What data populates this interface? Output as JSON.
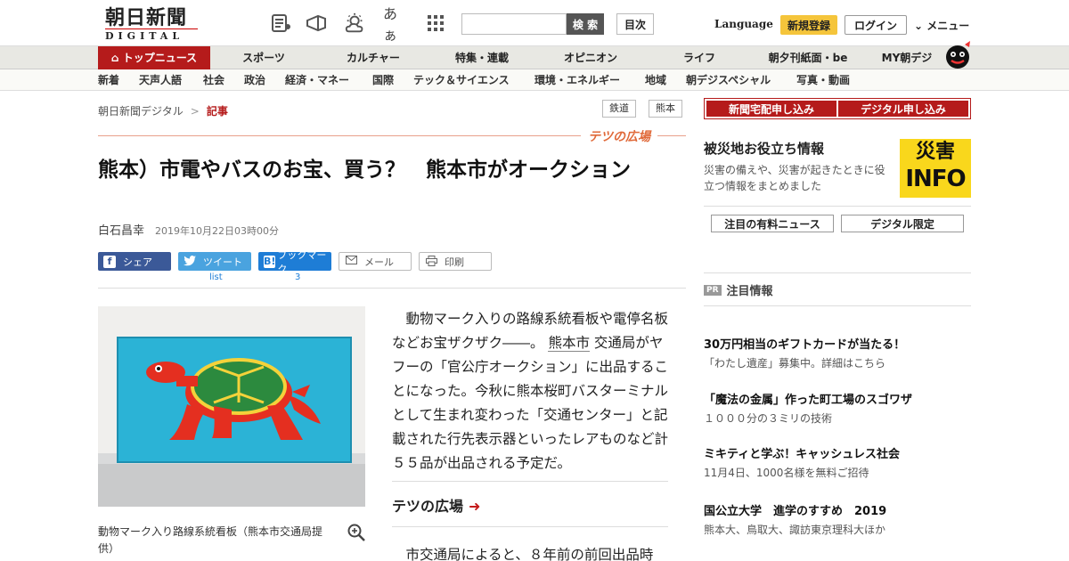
{
  "header": {
    "logo_jp": "朝日新聞",
    "logo_en": "DIGITAL",
    "icon_toggle_kana": "あぁ",
    "search_button": "検 索",
    "toc_button": "目次",
    "language": "Language",
    "register": "新規登録",
    "login": "ログイン",
    "menu": "メニュー"
  },
  "main_nav": [
    "トップニュース",
    "スポーツ",
    "カルチャー",
    "特集・連載",
    "オピニオン",
    "ライフ",
    "朝夕刊紙面・be",
    "MY朝デジ"
  ],
  "sub_nav": [
    "新着",
    "天声人語",
    "社会",
    "政治",
    "経済・マネー",
    "国際",
    "テック＆サイエンス",
    "環境・エネルギー",
    "地域",
    "朝デジスペシャル",
    "写真・動画"
  ],
  "breadcrumb": {
    "home": "朝日新聞デジタル",
    "separator": ">",
    "current": "記事"
  },
  "tags": [
    "鉄道",
    "熊本"
  ],
  "section_label": "テツの広場",
  "article": {
    "headline": "熊本）市電やバスのお宝、買う？　熊本市がオークション",
    "author": "白石昌幸",
    "date": "2019年10月22日03時00分",
    "caption": "動物マーク入り路線系統看板（熊本市交通局提供）",
    "body_before_link": "動物マーク入りの路線系統看板や電停名板などお宝ザクザク――。",
    "body_link": "熊本市",
    "body_after_link": "交通局がヤフーの「官公庁オークション」に出品することになった。今秋に熊本桜町バスターミナルとして生まれ変わった「交通センター」と記載された行先表示器といったレアものなど計５５品が出品される予定だ。",
    "related_link": "テツの広場",
    "body_next": "市交通局によると、８年前の前回出品時"
  },
  "share": {
    "facebook": "シェア",
    "twitter": "ツイート",
    "twitter_count": "list",
    "hatena_icon": "B!",
    "hatena": "ブックマーク",
    "hatena_count": "3",
    "mail": "メール",
    "print": "印刷"
  },
  "sidebar": {
    "subscribe_paper": "新聞宅配申し込み",
    "subscribe_digital": "デジタル申し込み",
    "disaster_title": "被災地お役立ち情報",
    "disaster_desc": "災害の備えや、災害が起きたときに役立つ情報をまとめました",
    "disaster_badge_top": "災害",
    "disaster_badge_bottom": "INFO",
    "pill_paid_news": "注目の有料ニュース",
    "pill_digital_only": "デジタル限定",
    "pr_tag": "PR",
    "pr_heading": "注目情報",
    "pr_items": [
      {
        "title": "30万円相当のギフトカードが当たる！",
        "desc": "「わたし遺産」募集中。詳細はこちら"
      },
      {
        "title": "「魔法の金属」作った町工場のスゴワザ",
        "desc": "１０００分の３ミリの技術"
      },
      {
        "title": "ミキティと学ぶ！キャッシュレス社会",
        "desc": "11月4日、1000名様を無料ご招待"
      },
      {
        "title": "国公立大学　進学のすすめ　2019",
        "desc": "熊本大、鳥取大、諏訪東京理科大ほか"
      }
    ]
  },
  "colors": {
    "brand_red": "#b51b1b",
    "accent_yellow": "#f5c53b",
    "section_orange": "#e06a3a"
  }
}
